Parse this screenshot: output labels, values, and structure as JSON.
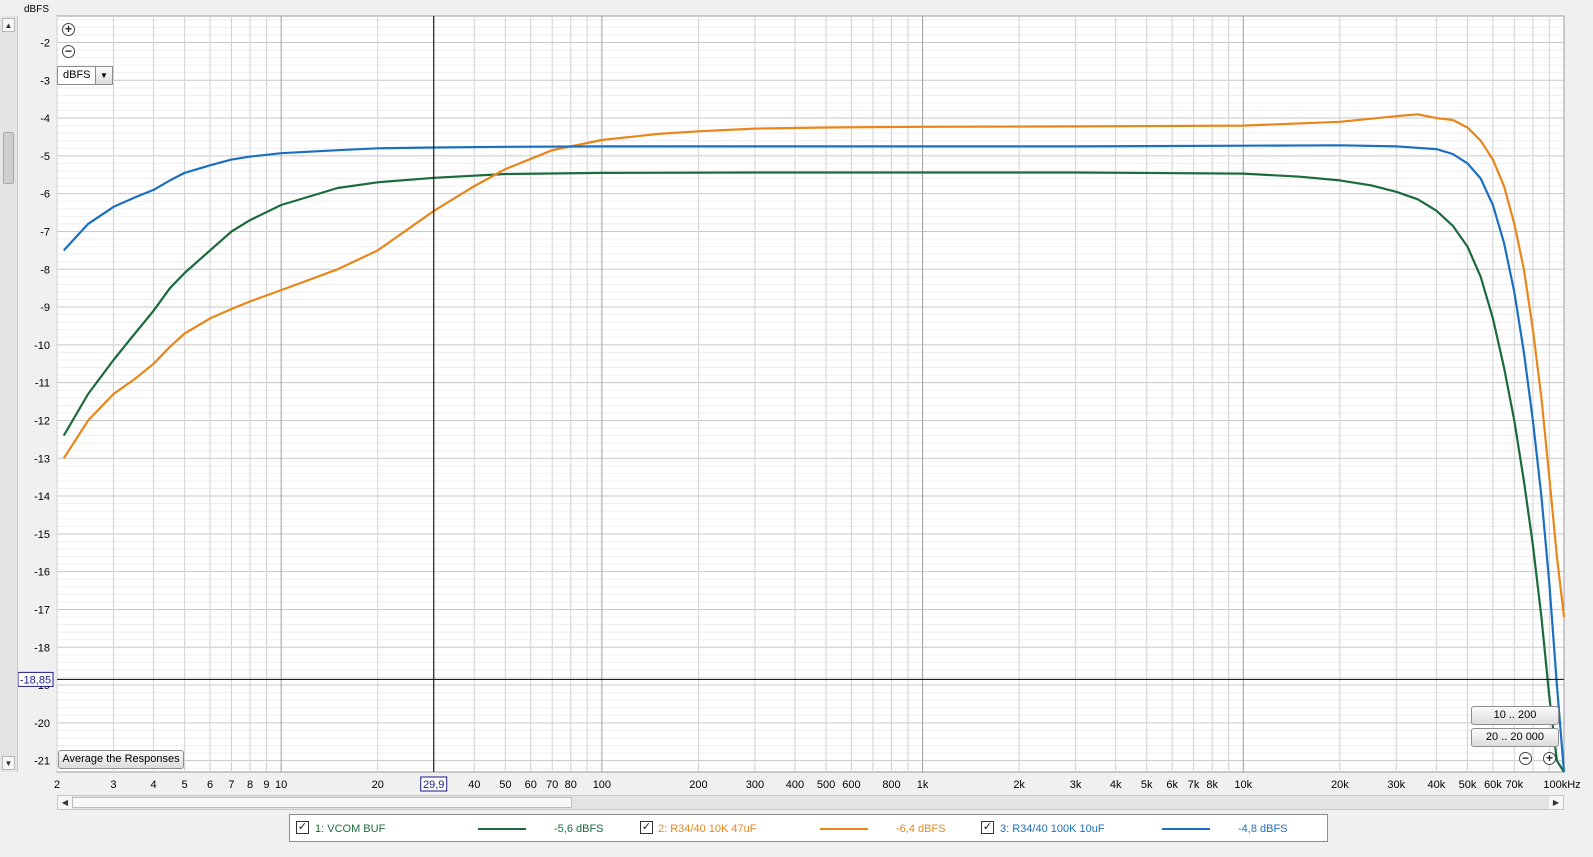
{
  "unit_select": {
    "value": "dBFS"
  },
  "buttons": {
    "average": "Average the Responses",
    "range_1": "10 .. 200",
    "range_2": "20 .. 20 000"
  },
  "cursor": {
    "x_label": "29,9",
    "y_label": "-18,85",
    "x_value": 29.9,
    "y_value": -18.85
  },
  "colors": {
    "series_1": "#1a6a3c",
    "series_2": "#e8861a",
    "series_3": "#1a6fc0"
  },
  "legend": [
    {
      "checked": true,
      "name": "1: VCOM BUF",
      "value": "-5,6 dBFS",
      "color": "#1a6a3c"
    },
    {
      "checked": true,
      "name": "2: R34/40 10K 47uF",
      "value": "-6,4 dBFS",
      "color": "#e8861a"
    },
    {
      "checked": true,
      "name": "3: R34/40 100K 10uF",
      "value": "-4,8 dBFS",
      "color": "#1a6fc0"
    }
  ],
  "chart_data": {
    "type": "line",
    "ylabel": "dBFS",
    "xscale": "log",
    "xlim": [
      2,
      100000
    ],
    "ylim": [
      -21.3,
      -1.3
    ],
    "grid": true,
    "y_ticks": [
      "-2",
      "-3",
      "-4",
      "-5",
      "-6",
      "-7",
      "-8",
      "-9",
      "-10",
      "-11",
      "-12",
      "-13",
      "-14",
      "-15",
      "-16",
      "-17",
      "-18",
      "-19",
      "-20",
      "-21"
    ],
    "x_ticks": [
      {
        "v": 2,
        "t": "2"
      },
      {
        "v": 3,
        "t": "3"
      },
      {
        "v": 4,
        "t": "4"
      },
      {
        "v": 5,
        "t": "5"
      },
      {
        "v": 6,
        "t": "6"
      },
      {
        "v": 7,
        "t": "7"
      },
      {
        "v": 8,
        "t": "8"
      },
      {
        "v": 9,
        "t": "9"
      },
      {
        "v": 10,
        "t": "10"
      },
      {
        "v": 20,
        "t": "20"
      },
      {
        "v": 40,
        "t": "40"
      },
      {
        "v": 50,
        "t": "50"
      },
      {
        "v": 60,
        "t": "60"
      },
      {
        "v": 70,
        "t": "70"
      },
      {
        "v": 80,
        "t": "80"
      },
      {
        "v": 100,
        "t": "100"
      },
      {
        "v": 200,
        "t": "200"
      },
      {
        "v": 300,
        "t": "300"
      },
      {
        "v": 400,
        "t": "400"
      },
      {
        "v": 500,
        "t": "500"
      },
      {
        "v": 600,
        "t": "600"
      },
      {
        "v": 800,
        "t": "800"
      },
      {
        "v": 1000,
        "t": "1k"
      },
      {
        "v": 2000,
        "t": "2k"
      },
      {
        "v": 3000,
        "t": "3k"
      },
      {
        "v": 4000,
        "t": "4k"
      },
      {
        "v": 5000,
        "t": "5k"
      },
      {
        "v": 6000,
        "t": "6k"
      },
      {
        "v": 7000,
        "t": "7k"
      },
      {
        "v": 8000,
        "t": "8k"
      },
      {
        "v": 10000,
        "t": "10k"
      },
      {
        "v": 20000,
        "t": "20k"
      },
      {
        "v": 30000,
        "t": "30k"
      },
      {
        "v": 40000,
        "t": "40k"
      },
      {
        "v": 50000,
        "t": "50k"
      },
      {
        "v": 60000,
        "t": "60k"
      },
      {
        "v": 70000,
        "t": "70k"
      },
      {
        "v": 100000,
        "t": "100kHz"
      }
    ],
    "series": [
      {
        "name": "1: VCOM BUF",
        "color": "#1a6a3c",
        "x": [
          2.1,
          2.5,
          3,
          3.5,
          4,
          4.5,
          5,
          6,
          7,
          8,
          10,
          15,
          20,
          30,
          50,
          100,
          300,
          1000,
          3000,
          10000,
          15000,
          20000,
          25000,
          30000,
          35000,
          40000,
          45000,
          50000,
          55000,
          60000,
          65000,
          70000,
          75000,
          80000,
          85000,
          90000,
          95000,
          100000
        ],
        "y": [
          -12.4,
          -11.3,
          -10.4,
          -9.7,
          -9.1,
          -8.5,
          -8.1,
          -7.5,
          -7.0,
          -6.7,
          -6.3,
          -5.85,
          -5.7,
          -5.58,
          -5.48,
          -5.45,
          -5.44,
          -5.44,
          -5.44,
          -5.47,
          -5.55,
          -5.65,
          -5.78,
          -5.95,
          -6.15,
          -6.45,
          -6.85,
          -7.4,
          -8.2,
          -9.3,
          -10.6,
          -12.0,
          -13.6,
          -15.3,
          -17.2,
          -19.3,
          -21.0,
          -21.3
        ]
      },
      {
        "name": "2: R34/40 10K 47uF",
        "color": "#e8861a",
        "x": [
          2.1,
          2.5,
          3,
          3.5,
          4,
          4.5,
          5,
          6,
          7,
          8,
          10,
          15,
          20,
          30,
          40,
          50,
          70,
          100,
          150,
          200,
          300,
          500,
          1000,
          3000,
          10000,
          20000,
          30000,
          35000,
          40000,
          45000,
          50000,
          55000,
          60000,
          65000,
          70000,
          75000,
          80000,
          85000,
          90000,
          95000,
          100000
        ],
        "y": [
          -13.0,
          -12.0,
          -11.3,
          -10.9,
          -10.5,
          -10.05,
          -9.7,
          -9.3,
          -9.05,
          -8.85,
          -8.55,
          -8.0,
          -7.5,
          -6.45,
          -5.8,
          -5.35,
          -4.85,
          -4.58,
          -4.42,
          -4.35,
          -4.28,
          -4.25,
          -4.23,
          -4.22,
          -4.2,
          -4.1,
          -3.95,
          -3.9,
          -4.0,
          -4.05,
          -4.25,
          -4.6,
          -5.1,
          -5.8,
          -6.8,
          -8.0,
          -9.6,
          -11.4,
          -13.5,
          -15.6,
          -17.2
        ]
      },
      {
        "name": "3: R34/40 100K 10uF",
        "color": "#1a6fc0",
        "x": [
          2.1,
          2.5,
          3,
          3.5,
          4,
          4.5,
          5,
          6,
          7,
          8,
          10,
          15,
          20,
          30,
          50,
          100,
          300,
          1000,
          3000,
          10000,
          20000,
          30000,
          40000,
          45000,
          50000,
          55000,
          60000,
          65000,
          70000,
          75000,
          80000,
          85000,
          90000,
          95000,
          100000
        ],
        "y": [
          -7.5,
          -6.8,
          -6.35,
          -6.1,
          -5.9,
          -5.65,
          -5.45,
          -5.25,
          -5.1,
          -5.02,
          -4.93,
          -4.85,
          -4.8,
          -4.78,
          -4.76,
          -4.75,
          -4.75,
          -4.75,
          -4.75,
          -4.73,
          -4.72,
          -4.75,
          -4.82,
          -4.95,
          -5.2,
          -5.6,
          -6.3,
          -7.3,
          -8.6,
          -10.2,
          -12.0,
          -14.0,
          -16.3,
          -19.0,
          -21.3
        ]
      }
    ]
  }
}
